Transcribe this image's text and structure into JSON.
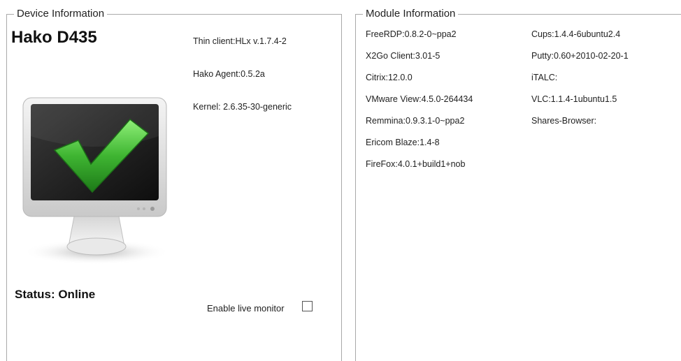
{
  "device": {
    "legend": "Device Information",
    "name": "Hako D435",
    "thin_client": "Thin client:HLx v.1.7.4-2",
    "agent": "Hako Agent:0.5.2a",
    "kernel": "Kernel: 2.6.35-30-generic",
    "status": "Status: Online",
    "live_monitor_label": "Enable live monitor",
    "live_monitor_checked": false,
    "monitor_icon": "monitor-checkmark-icon",
    "accent_green": "#3fb532"
  },
  "modules": {
    "legend": "Module Information",
    "left_column": [
      "FreeRDP:0.8.2-0~ppa2",
      "X2Go Client:3.01-5",
      "Citrix:12.0.0",
      "VMware View:4.5.0-264434",
      "Remmina:0.9.3.1-0~ppa2",
      "Ericom Blaze:1.4-8",
      "FireFox:4.0.1+build1+nob"
    ],
    "right_column": [
      "Cups:1.4.4-6ubuntu2.4",
      "Putty:0.60+2010-02-20-1",
      "iTALC:",
      "VLC:1.1.4-1ubuntu1.5",
      "Shares-Browser:"
    ]
  }
}
